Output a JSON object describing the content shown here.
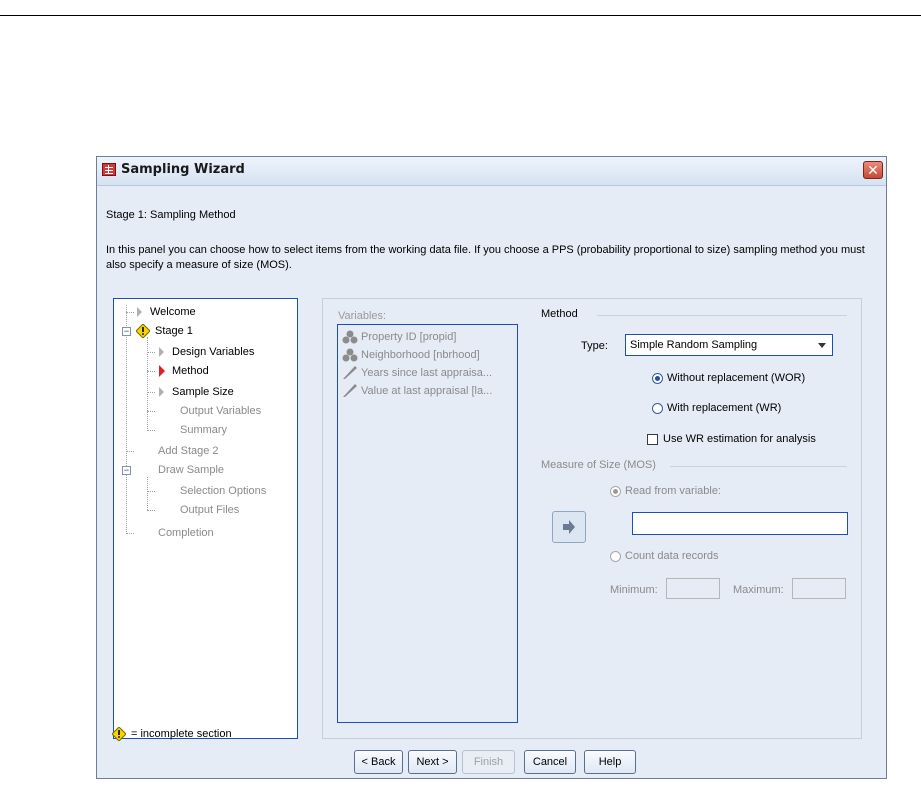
{
  "window": {
    "title": "Sampling Wizard",
    "close_glyph": "✕"
  },
  "stage_heading": "Stage 1: Sampling Method",
  "description": "In this panel you can choose how to select items from the working data file. If you choose a PPS (probability proportional to size) sampling method you must also specify a measure of size (MOS).",
  "tree": {
    "welcome": "Welcome",
    "stage1": "Stage 1",
    "design_variables": "Design Variables",
    "method": "Method",
    "sample_size": "Sample Size",
    "output_variables": "Output Variables",
    "summary": "Summary",
    "add_stage2": "Add Stage 2",
    "draw_sample": "Draw Sample",
    "selection_options": "Selection Options",
    "output_files": "Output Files",
    "completion": "Completion"
  },
  "legend": "= incomplete section",
  "variables": {
    "label": "Variables:",
    "items": [
      {
        "label": "Property ID [propid]",
        "icon": "nominal-icon"
      },
      {
        "label": "Neighborhood [nbrhood]",
        "icon": "nominal-icon"
      },
      {
        "label": "Years since last appraisa...",
        "icon": "scale-icon"
      },
      {
        "label": "Value at last appraisal [la...",
        "icon": "scale-icon"
      }
    ]
  },
  "method": {
    "group_title": "Method",
    "type_label": "Type:",
    "type_value": "Simple Random Sampling",
    "without_replacement": "Without replacement (WOR)",
    "with_replacement": "With replacement (WR)",
    "use_wr_estimation": "Use WR estimation for analysis"
  },
  "mos": {
    "group_title": "Measure of Size (MOS)",
    "read_from_variable": "Read from variable:",
    "count_data_records": "Count data records",
    "minimum_label": "Minimum:",
    "maximum_label": "Maximum:"
  },
  "buttons": {
    "back": "< Back",
    "next": "Next >",
    "finish": "Finish",
    "cancel": "Cancel",
    "help": "Help"
  }
}
